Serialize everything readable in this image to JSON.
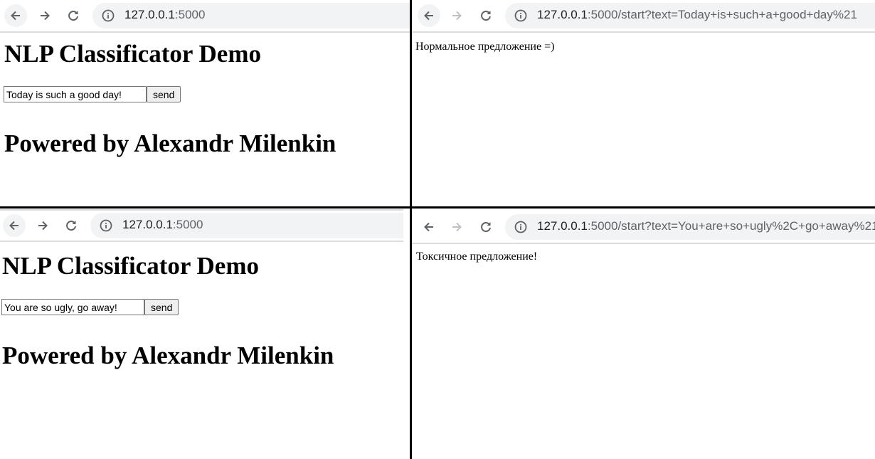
{
  "colors": {
    "divider": "#000000",
    "omnibox_bg": "#f1f3f4",
    "toolbar_icon": "#5f6368",
    "disabled_icon": "#bdc1c6"
  },
  "icons": [
    "back-arrow-icon",
    "forward-arrow-icon",
    "reload-icon",
    "info-icon"
  ],
  "windows": {
    "top_left": {
      "url_host": "127.0.0.1",
      "url_path": ":5000",
      "page": {
        "title": "NLP Classificator Demo",
        "input_value": "Today is such a good day!",
        "send_label": "send",
        "footer": "Powered by Alexandr Milenkin"
      }
    },
    "top_right": {
      "url_host": "127.0.0.1",
      "url_path": ":5000/start?text=Today+is+such+a+good+day%21",
      "result": "Нормальное предложение =)"
    },
    "bottom_left": {
      "url_host": "127.0.0.1",
      "url_path": ":5000",
      "page": {
        "title": "NLP Classificator Demo",
        "input_value": "You are so ugly, go away!",
        "send_label": "send",
        "footer": "Powered by Alexandr Milenkin"
      }
    },
    "bottom_right": {
      "url_host": "127.0.0.1",
      "url_path": ":5000/start?text=You+are+so+ugly%2C+go+away%21",
      "result": "Токсичное предложение!"
    }
  }
}
